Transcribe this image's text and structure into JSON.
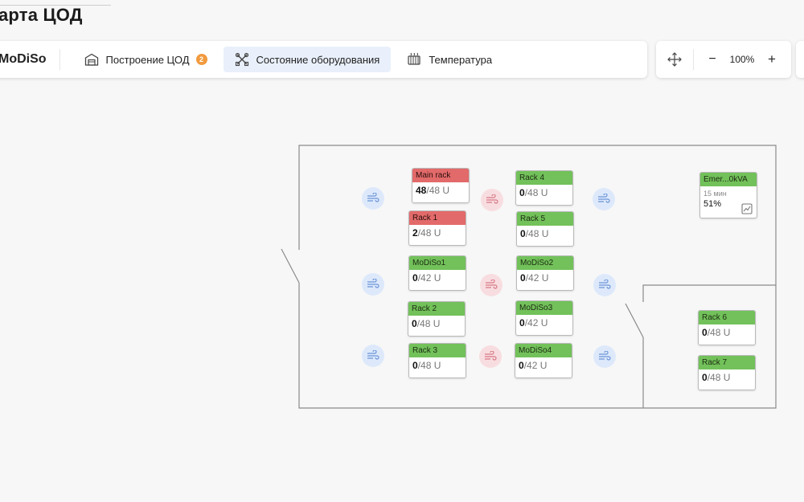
{
  "page_title": "арта ЦОД",
  "toolbar": {
    "brand": "MoDiSo",
    "tabs": [
      {
        "label": "Построение ЦОД",
        "icon": "building-icon",
        "badge": "2"
      },
      {
        "label": "Состояние оборудования",
        "icon": "tools-icon",
        "active": true
      },
      {
        "label": "Температура",
        "icon": "radiator-icon"
      }
    ],
    "zoom_value": "100%",
    "zoom_minus": "−",
    "zoom_plus": "+"
  },
  "racks": [
    {
      "name": "Main rack",
      "used": "48",
      "cap": "/48 U",
      "status": "red"
    },
    {
      "name": "Rack 1",
      "used": "2",
      "cap": "/48 U",
      "status": "red"
    },
    {
      "name": "MoDiSo1",
      "used": "0",
      "cap": "/42 U",
      "status": "green"
    },
    {
      "name": "Rack 2",
      "used": "0",
      "cap": "/48 U",
      "status": "green"
    },
    {
      "name": "Rack 3",
      "used": "0",
      "cap": "/48 U",
      "status": "green"
    },
    {
      "name": "Rack 4",
      "used": "0",
      "cap": "/48 U",
      "status": "green"
    },
    {
      "name": "Rack 5",
      "used": "0",
      "cap": "/48 U",
      "status": "green"
    },
    {
      "name": "MoDiSo2",
      "used": "0",
      "cap": "/42 U",
      "status": "green"
    },
    {
      "name": "MoDiSo3",
      "used": "0",
      "cap": "/42 U",
      "status": "green"
    },
    {
      "name": "MoDiSo4",
      "used": "0",
      "cap": "/42 U",
      "status": "green"
    },
    {
      "name": "Rack 6",
      "used": "0",
      "cap": "/48 U",
      "status": "green"
    },
    {
      "name": "Rack 7",
      "used": "0",
      "cap": "/48 U",
      "status": "green"
    }
  ],
  "ups": {
    "name": "Emer...0kVA",
    "time": "15 мин",
    "percent": "51%"
  },
  "colors": {
    "green": "#72c15a",
    "red": "#e36a6a",
    "fan_blue": "#dde9fb",
    "fan_pink": "#f8dde0",
    "badge": "#f19a3e",
    "active_tab": "#e9f0fb"
  }
}
